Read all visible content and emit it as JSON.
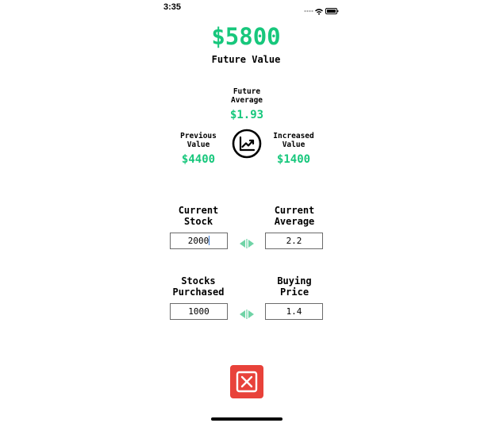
{
  "status_bar": {
    "time": "3:35"
  },
  "summary": {
    "future_value": "$5800",
    "future_value_label": "Future Value"
  },
  "future_average": {
    "label_line1": "Future",
    "label_line2": "Average",
    "value": "$1.93"
  },
  "previous_value": {
    "label_line1": "Previous",
    "label_line2": "Value",
    "value": "$4400"
  },
  "increased_value": {
    "label_line1": "Increased",
    "label_line2": "Value",
    "value": "$1400"
  },
  "current_stock": {
    "label_line1": "Current",
    "label_line2": "Stock",
    "value": "2000"
  },
  "current_average": {
    "label_line1": "Current",
    "label_line2": "Average",
    "value": "2.2"
  },
  "stocks_purchased": {
    "label_line1": "Stocks",
    "label_line2": "Purchased",
    "value": "1000"
  },
  "buying_price": {
    "label_line1": "Buying",
    "label_line2": "Price",
    "value": "1.4"
  },
  "colors": {
    "accent": "#17c77c",
    "danger": "#e8423a"
  },
  "icons": {
    "chart": "chart-trend-icon",
    "swap": "swap-arrows-icon",
    "close": "close-icon"
  }
}
